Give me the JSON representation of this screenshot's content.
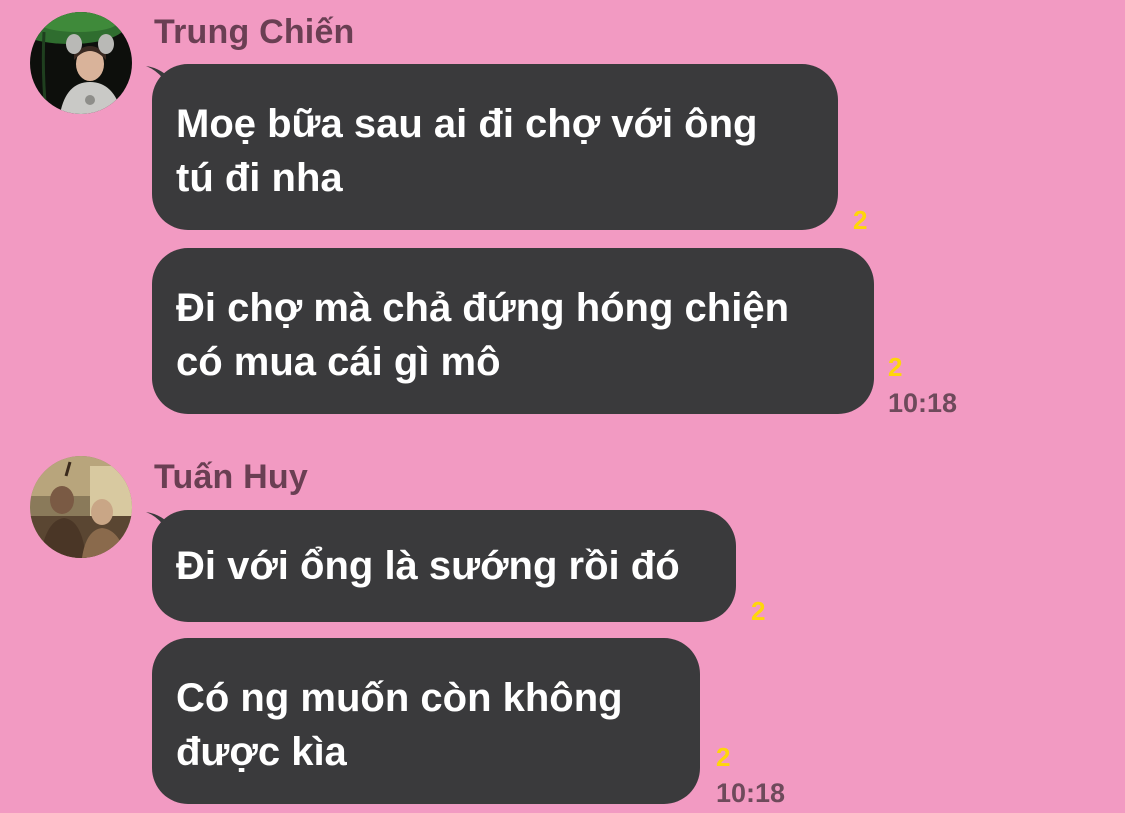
{
  "messages": [
    {
      "sender": "Trung Chiến",
      "avatar": "profile-photo-trung-chien",
      "bubbles": [
        {
          "lines": [
            "Moẹ bữa sau ai đi chợ với ông",
            "tú đi nha"
          ],
          "read_count": "2",
          "time": ""
        },
        {
          "lines": [
            "Đi chợ mà chả đứng hóng chiện",
            "có mua cái gì mô"
          ],
          "read_count": "2",
          "time": "10:18"
        }
      ]
    },
    {
      "sender": "Tuấn Huy",
      "avatar": "profile-photo-tuan-huy",
      "bubbles": [
        {
          "lines": [
            "Đi với ổng là sướng rồi đó"
          ],
          "read_count": "2",
          "time": ""
        },
        {
          "lines": [
            "Có ng muốn còn không",
            "được kìa"
          ],
          "read_count": "2",
          "time": "10:18"
        }
      ]
    }
  ],
  "colors": {
    "background": "#f29ac2",
    "bubble": "#3a3a3c",
    "bubble_text": "#ffffff",
    "read_count": "#ffd60a",
    "sender_name": "#6a3f53",
    "timestamp": "#6e4a5b"
  }
}
